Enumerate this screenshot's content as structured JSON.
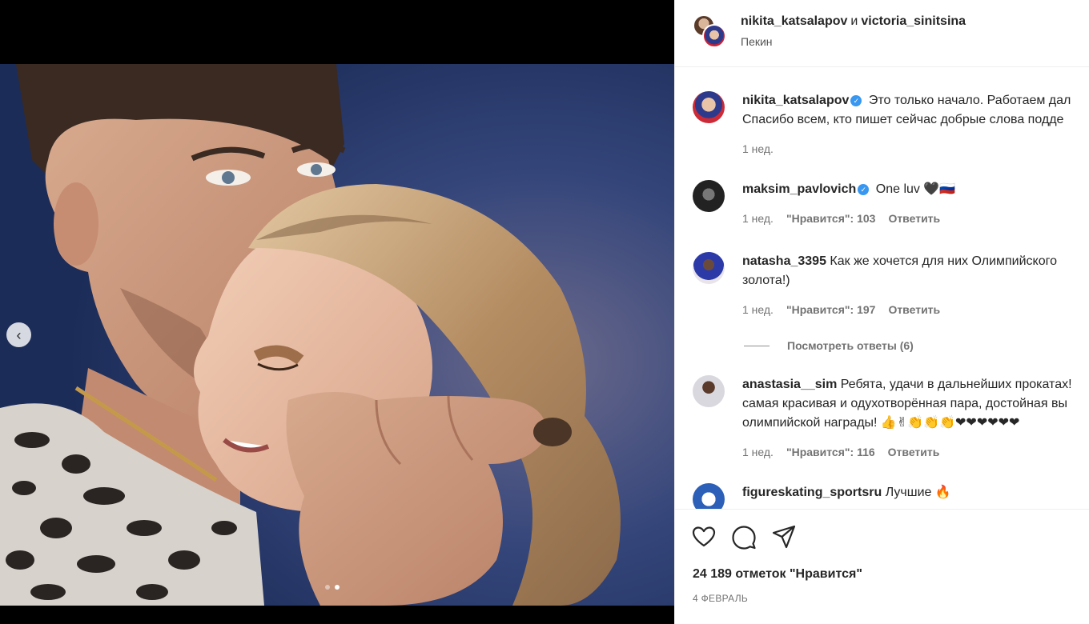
{
  "header": {
    "user1": "nikita_katsalapov",
    "conjunction": "и",
    "user2": "victoria_sinitsina",
    "location": "Пекин"
  },
  "comments": [
    {
      "username": "nikita_katsalapov",
      "verified": true,
      "line1": "Это только начало. Работаем дал",
      "line2": "Спасибо всем, кто пишет сейчас добрые слова подде",
      "time": "1 нед."
    },
    {
      "username": "maksim_pavlovich",
      "verified": true,
      "text": "One luv 🖤🇷🇺",
      "time": "1 нед.",
      "likes": "\"Нравится\": 103",
      "reply": "Ответить"
    },
    {
      "username": "natasha_3395",
      "line1": "Как же хочется для них Олимпийского",
      "line2": "золота!)",
      "time": "1 нед.",
      "likes": "\"Нравится\": 197",
      "reply": "Ответить",
      "view_replies": "Посмотреть ответы (6)"
    },
    {
      "username": "anastasia__sim",
      "line1": "Ребята, удачи в дальнейших прокатах!",
      "line2": "самая красивая и одухотворённая пара, достойная вы",
      "line3": "олимпийской награды! 👍✌👏👏👏❤❤❤❤❤❤",
      "time": "1 нед.",
      "likes": "\"Нравится\": 116",
      "reply": "Ответить"
    },
    {
      "username": "figureskating_sportsru",
      "text": "Лучшие 🔥"
    }
  ],
  "actions": {
    "likes": "24 189 отметок \"Нравится\"",
    "date": "4 ФЕВРАЛЬ"
  },
  "carousel": {
    "count": 2,
    "active": 2
  }
}
